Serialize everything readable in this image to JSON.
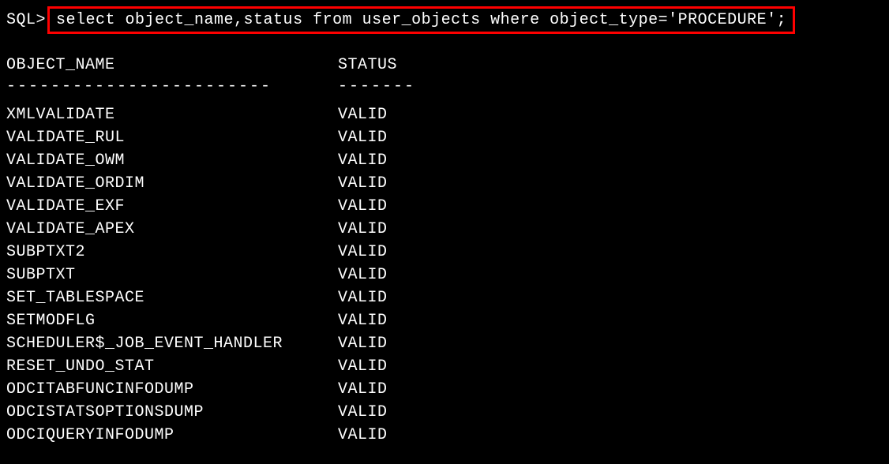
{
  "prompt": "SQL>",
  "query": "select object_name,status from user_objects where object_type='PROCEDURE';",
  "headers": {
    "object_name": "OBJECT_NAME",
    "status": "STATUS"
  },
  "separators": {
    "object_name": "------------------------",
    "status": "-------"
  },
  "rows": [
    {
      "object_name": "XMLVALIDATE",
      "status": "VALID"
    },
    {
      "object_name": "VALIDATE_RUL",
      "status": "VALID"
    },
    {
      "object_name": "VALIDATE_OWM",
      "status": "VALID"
    },
    {
      "object_name": "VALIDATE_ORDIM",
      "status": "VALID"
    },
    {
      "object_name": "VALIDATE_EXF",
      "status": "VALID"
    },
    {
      "object_name": "VALIDATE_APEX",
      "status": "VALID"
    },
    {
      "object_name": "SUBPTXT2",
      "status": "VALID"
    },
    {
      "object_name": "SUBPTXT",
      "status": "VALID"
    },
    {
      "object_name": "SET_TABLESPACE",
      "status": "VALID"
    },
    {
      "object_name": "SETMODFLG",
      "status": "VALID"
    },
    {
      "object_name": "SCHEDULER$_JOB_EVENT_HANDLER",
      "status": "VALID"
    },
    {
      "object_name": "RESET_UNDO_STAT",
      "status": "VALID"
    },
    {
      "object_name": "ODCITABFUNCINFODUMP",
      "status": "VALID"
    },
    {
      "object_name": "ODCISTATSOPTIONSDUMP",
      "status": "VALID"
    },
    {
      "object_name": "ODCIQUERYINFODUMP",
      "status": "VALID"
    }
  ]
}
